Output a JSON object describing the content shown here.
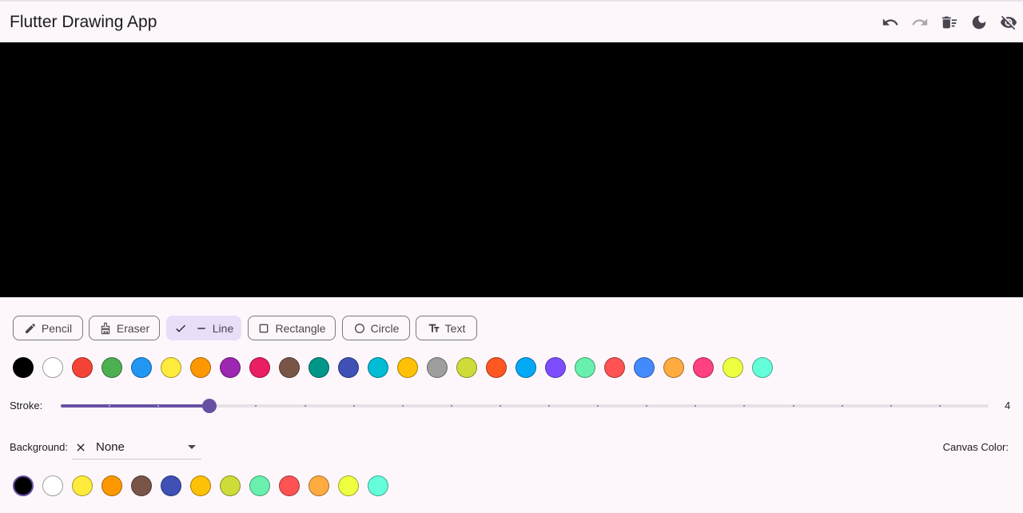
{
  "app": {
    "title": "Flutter Drawing App",
    "actions": [
      {
        "name": "undo-button",
        "icon": "undo-icon"
      },
      {
        "name": "redo-button",
        "icon": "redo-icon",
        "disabled": true
      },
      {
        "name": "clear-button",
        "icon": "delete-sweep-icon"
      },
      {
        "name": "theme-toggle-button",
        "icon": "dark-mode-icon"
      },
      {
        "name": "visibility-toggle-button",
        "icon": "visibility-off-icon"
      }
    ]
  },
  "canvas": {
    "background": "#000000"
  },
  "tools": [
    {
      "label": "Pencil",
      "icon": "pencil-icon",
      "selected": false
    },
    {
      "label": "Eraser",
      "icon": "eraser-icon",
      "selected": false
    },
    {
      "label": "Line",
      "icon": "line-icon",
      "selected": true
    },
    {
      "label": "Rectangle",
      "icon": "square-icon",
      "selected": false
    },
    {
      "label": "Circle",
      "icon": "circle-icon",
      "selected": false
    },
    {
      "label": "Text",
      "icon": "text-fields-icon",
      "selected": false
    }
  ],
  "stroke_colors": [
    "#000000",
    "#ffffff",
    "#f44336",
    "#4caf50",
    "#2196f3",
    "#ffeb3b",
    "#ff9800",
    "#9c27b0",
    "#e91e63",
    "#795548",
    "#009688",
    "#3f51b5",
    "#00bcd4",
    "#ffc107",
    "#9e9e9e",
    "#cddc39",
    "#ff5722",
    "#03a9f4",
    "#7c4dff",
    "#69f0ae",
    "#ff5252",
    "#448aff",
    "#ffab40",
    "#ff4081",
    "#eeff41",
    "#64ffda"
  ],
  "stroke": {
    "label": "Stroke:",
    "value": "4",
    "fraction": 0.16,
    "divisions": 19
  },
  "background": {
    "label": "Background:",
    "selected": "None"
  },
  "canvas_color": {
    "label": "Canvas Color:"
  },
  "background_colors": [
    "#000000",
    "#ffffff",
    "#ffeb3b",
    "#ff9800",
    "#795548",
    "#3f51b5",
    "#ffc107",
    "#cddc39",
    "#69f0ae",
    "#ff5252",
    "#ffab40",
    "#eeff41",
    "#64ffda"
  ]
}
